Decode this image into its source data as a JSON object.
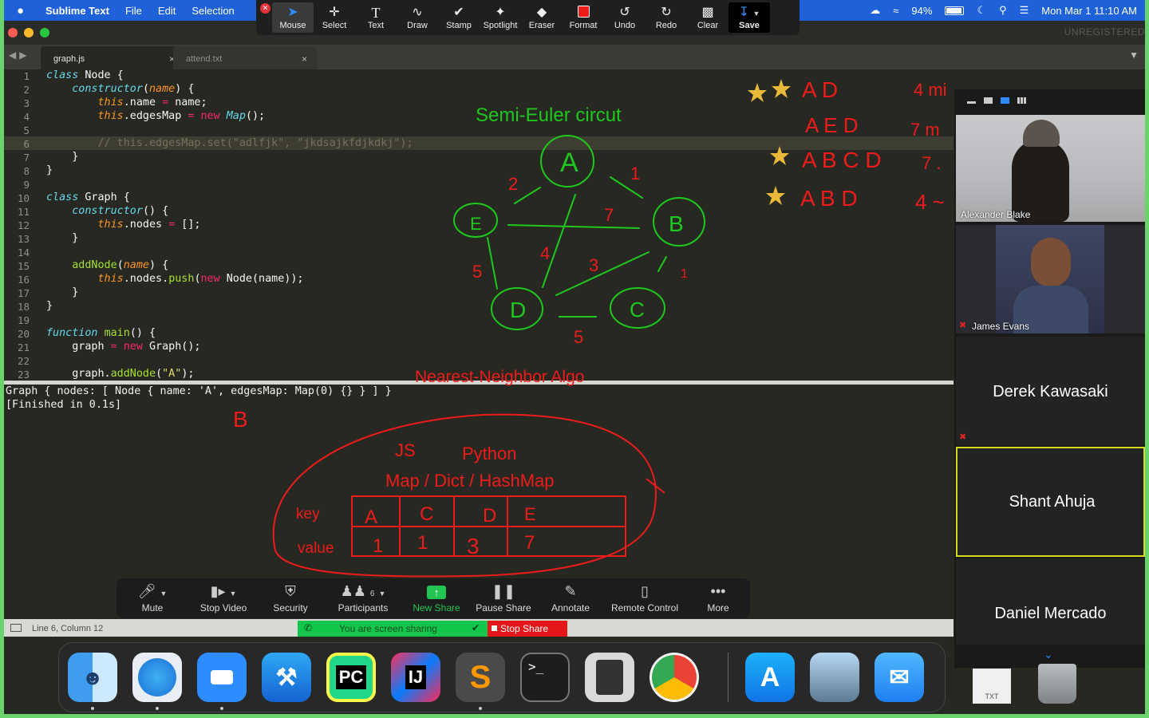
{
  "menubar": {
    "app_name": "Sublime Text",
    "items": [
      "File",
      "Edit",
      "Selection"
    ],
    "battery": "94%",
    "datetime": "Mon Mar 1  11:10 AM"
  },
  "window": {
    "unregistered": "UNREGISTERED"
  },
  "tabs": [
    {
      "label": "graph.js",
      "close": "×"
    },
    {
      "label": "attend.txt",
      "close": "×"
    }
  ],
  "annotate_toolbar": {
    "tools": [
      "Mouse",
      "Select",
      "Text",
      "Draw",
      "Stamp",
      "Spotlight",
      "Eraser",
      "Format",
      "Undo",
      "Redo",
      "Clear",
      "Save"
    ]
  },
  "code": {
    "line_numbers": [
      "1",
      "2",
      "3",
      "4",
      "5",
      "6",
      "7",
      "8",
      "9",
      "10",
      "11",
      "12",
      "13",
      "14",
      "15",
      "16",
      "17",
      "18",
      "19",
      "20",
      "21",
      "22",
      "23"
    ],
    "current_line": 6
  },
  "output": {
    "line1": "Graph { nodes: [ Node { name: 'A', edgesMap: Map(0) {} } ] }",
    "line2": "[Finished in 0.1s]"
  },
  "statusbar": {
    "position": "Line 6, Column 12"
  },
  "whiteboard": {
    "title_green": "Semi-Euler circut",
    "title_red": "Nearest-Neighbor Algo",
    "nodes": [
      "A",
      "B",
      "C",
      "D",
      "E"
    ],
    "edge_weights": [
      "2",
      "1",
      "7",
      "4",
      "3",
      "5",
      "1",
      "5"
    ],
    "paths": [
      {
        "star": true,
        "text": "A D",
        "cost": "4 mi"
      },
      {
        "star": false,
        "text": "A E D",
        "cost": "7 m"
      },
      {
        "star": true,
        "text": "A B C D",
        "cost": "7 ."
      },
      {
        "star": true,
        "text": "A B D",
        "cost": "4 ~"
      }
    ],
    "b_label": "B",
    "js": "JS",
    "python": "Python",
    "map_label": "Map / Dict / HashMap",
    "key_label": "key",
    "value_label": "value",
    "table_keys": [
      "A",
      "C",
      "D",
      "E"
    ],
    "table_values": [
      "1",
      "1",
      "3",
      "7"
    ]
  },
  "participants": [
    {
      "name": "Alexander Blake",
      "video": true
    },
    {
      "name": "James Evans",
      "video": true,
      "muted": true
    },
    {
      "name": "Derek Kawasaki",
      "video": false,
      "muted": true
    },
    {
      "name": "Shant Ahuja",
      "video": false,
      "active": true
    },
    {
      "name": "Daniel Mercado",
      "video": false
    }
  ],
  "meeting_controls": {
    "mute": "Mute",
    "stop_video": "Stop Video",
    "security": "Security",
    "participants": "Participants",
    "participants_count": "6",
    "new_share": "New Share",
    "pause_share": "Pause Share",
    "annotate": "Annotate",
    "remote_control": "Remote Control",
    "more": "More",
    "sharing_status": "You are screen sharing",
    "stop_share": "Stop Share"
  },
  "dock": {
    "pycharm": "PC",
    "intellij": "IJ",
    "terminal": ">_",
    "txt": "TXT"
  },
  "colors": {
    "menubar": "#1f61d8",
    "annotation_green": "#1ec81e",
    "annotation_red": "#ee1b1b",
    "zoom_green": "#23c552",
    "share_red": "#e5161a"
  }
}
